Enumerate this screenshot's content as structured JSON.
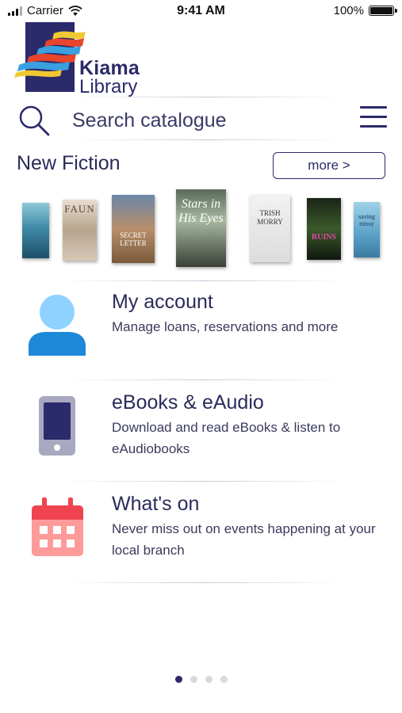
{
  "status_bar": {
    "carrier": "Carrier",
    "time": "9:41 AM",
    "battery": "100%"
  },
  "logo": {
    "line1": "Kiama",
    "line2": "Library"
  },
  "search": {
    "placeholder": "Search catalogue"
  },
  "new_fiction": {
    "title": "New Fiction",
    "more_label": "more >",
    "books": [
      {
        "name": "book-cover-1",
        "text": ""
      },
      {
        "name": "book-cover-2",
        "text": "FAUN"
      },
      {
        "name": "book-cover-3",
        "text": "SECRET LETTER"
      },
      {
        "name": "book-cover-4",
        "text": "Stars in His Eyes"
      },
      {
        "name": "book-cover-5",
        "text": "TRISH MORRY"
      },
      {
        "name": "book-cover-6",
        "text": "RUINS"
      },
      {
        "name": "book-cover-7",
        "text": "saving missy"
      }
    ]
  },
  "features": [
    {
      "title": "My account",
      "description": "Manage loans, reservations and more",
      "icon": "user-icon"
    },
    {
      "title": "eBooks & eAudio",
      "description": "Download and read eBooks & listen to eAudiobooks",
      "icon": "phone-icon"
    },
    {
      "title": "What's on",
      "description": "Never miss out on events happening at your local branch",
      "icon": "calendar-icon"
    }
  ],
  "pagination": {
    "current": 1,
    "total": 4
  },
  "colors": {
    "brand": "#2b2a6a",
    "user_icon": "#8fd1ff",
    "user_icon_body": "#1e88d9",
    "phone": "#a8a8c0",
    "calendar": "#ef4350"
  }
}
